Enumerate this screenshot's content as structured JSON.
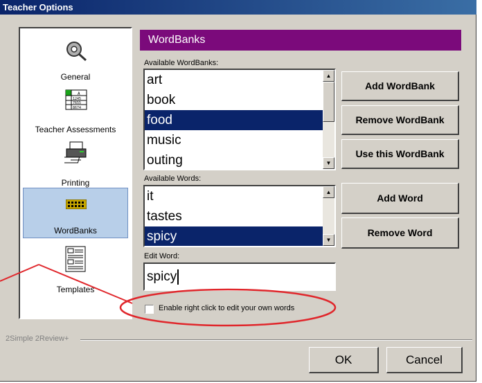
{
  "window": {
    "title": "Teacher Options"
  },
  "sidebar": {
    "items": [
      {
        "label": "General"
      },
      {
        "label": "Teacher Assessments"
      },
      {
        "label": "Printing"
      },
      {
        "label": "WordBanks"
      },
      {
        "label": "Templates"
      }
    ]
  },
  "header": {
    "title": "WordBanks"
  },
  "wordbanks": {
    "label": "Available WordBanks:",
    "items": [
      "art",
      "book",
      "food",
      "music",
      "outing"
    ],
    "selected": "food"
  },
  "words": {
    "label": "Available Words:",
    "items": [
      "it",
      "tastes",
      "spicy"
    ],
    "selected": "spicy"
  },
  "edit_word": {
    "label": "Edit Word:",
    "value": "spicy"
  },
  "buttons": {
    "add_wordbank": "Add WordBank",
    "remove_wordbank": "Remove WordBank",
    "use_wordbank": "Use this WordBank",
    "add_word": "Add Word",
    "remove_word": "Remove Word",
    "ok": "OK",
    "cancel": "Cancel"
  },
  "checkbox": {
    "label": "Enable right click to edit your own words",
    "checked": false
  },
  "footer": {
    "brand": "2Simple 2Review+"
  },
  "colors": {
    "header_bg": "#7b0a7b",
    "selection": "#0a246a",
    "annotation": "#e0262b"
  }
}
